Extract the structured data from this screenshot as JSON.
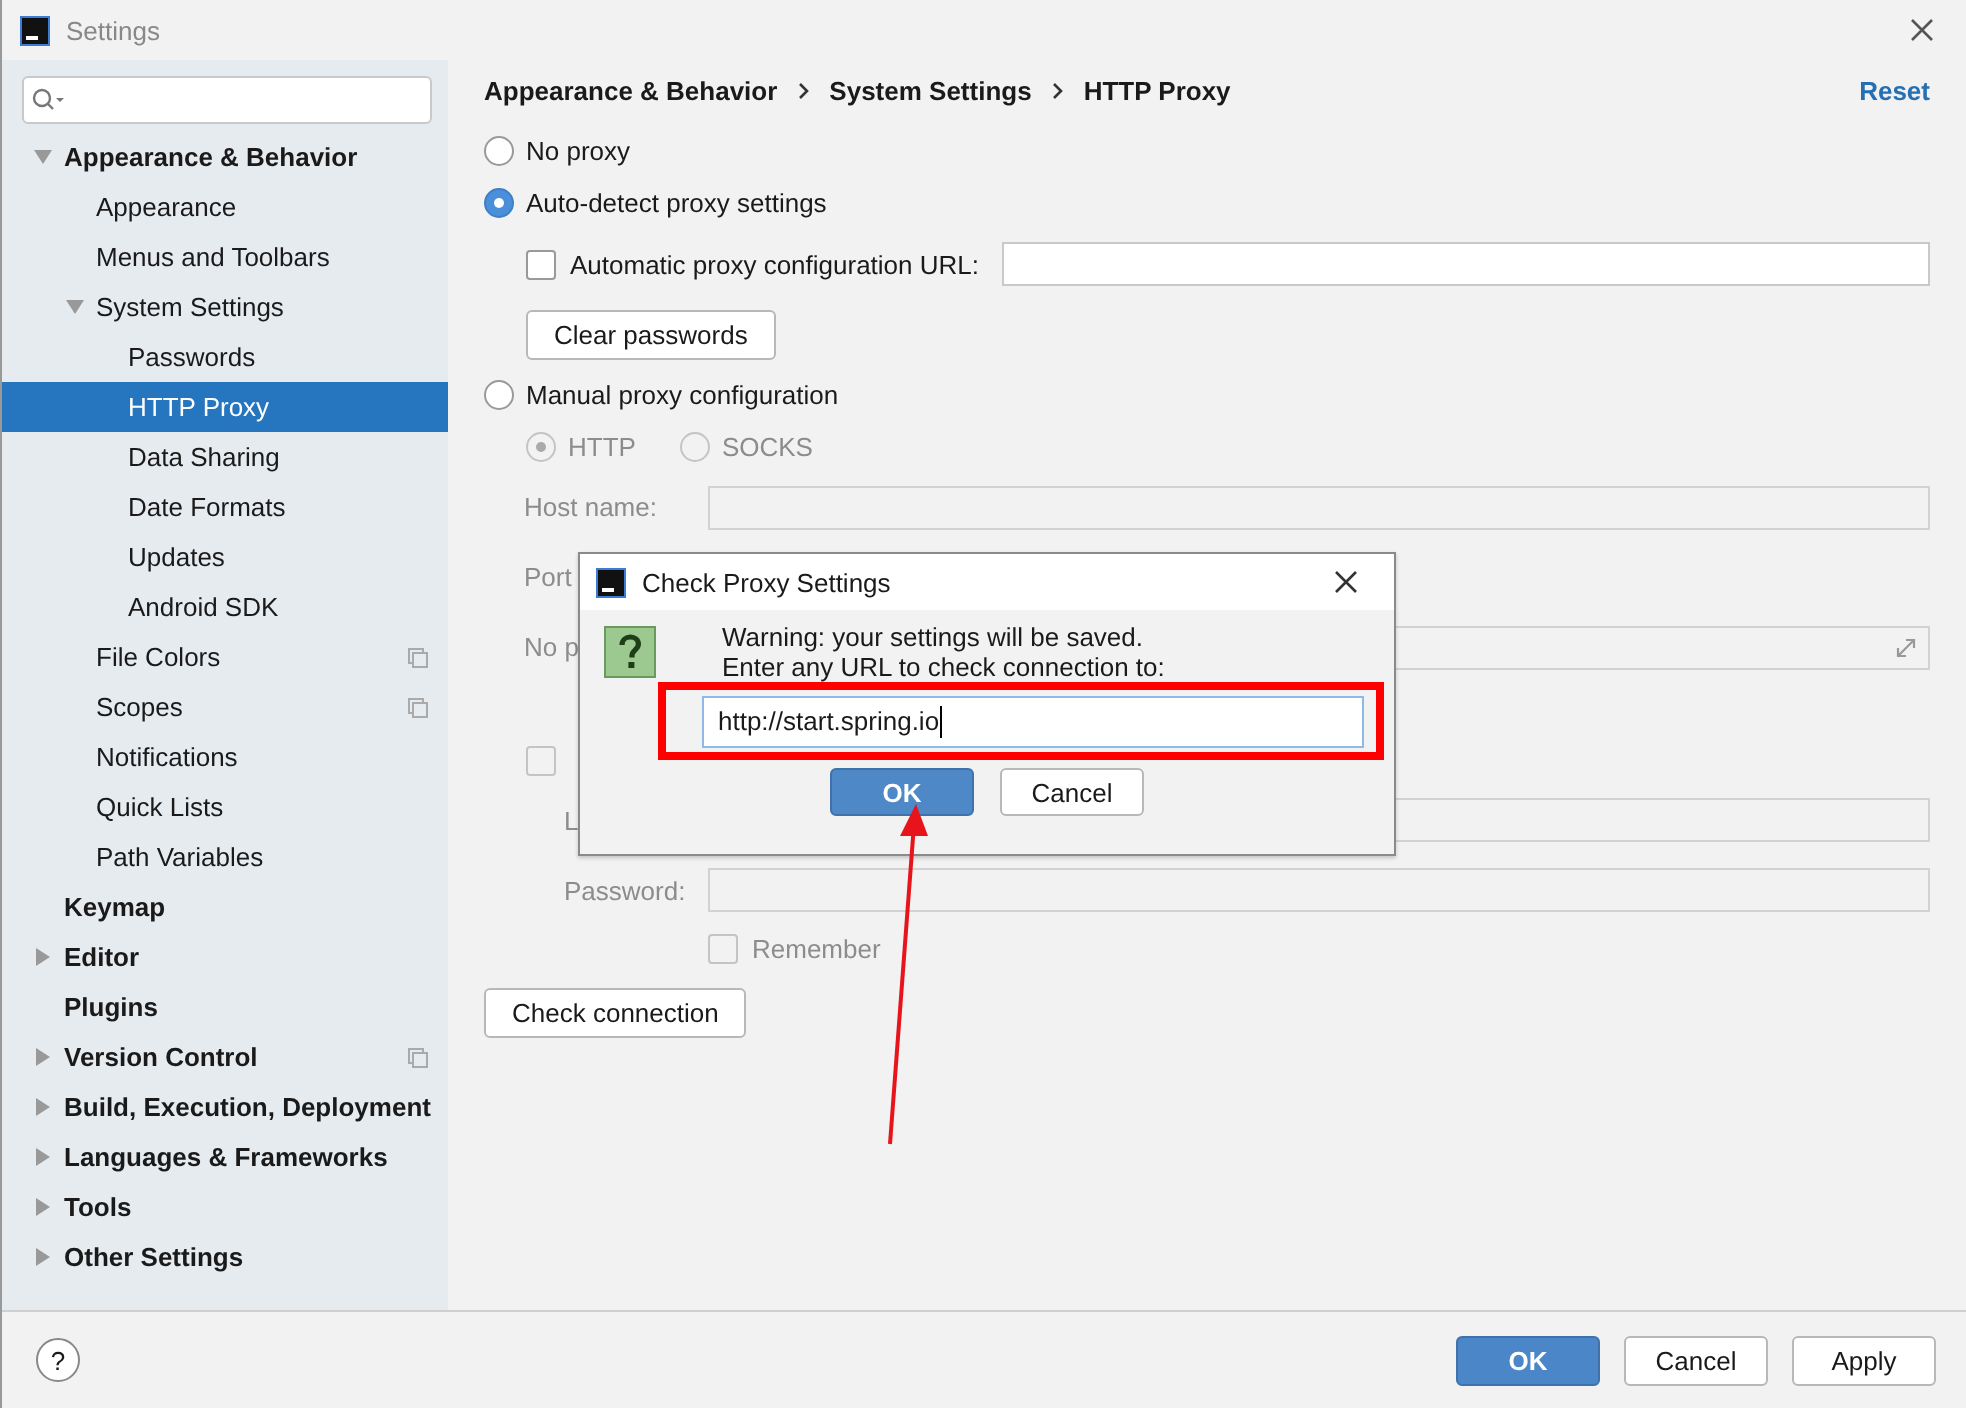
{
  "window": {
    "title": "Settings"
  },
  "sidebar": {
    "items": [
      {
        "label": "Appearance & Behavior",
        "expanded": true,
        "selected": false,
        "children": [
          {
            "label": "Appearance",
            "selected": false
          },
          {
            "label": "Menus and Toolbars",
            "selected": false
          },
          {
            "label": "System Settings",
            "expanded": true,
            "selected": false,
            "children": [
              {
                "label": "Passwords",
                "selected": false
              },
              {
                "label": "HTTP Proxy",
                "selected": true
              },
              {
                "label": "Data Sharing",
                "selected": false
              },
              {
                "label": "Date Formats",
                "selected": false
              },
              {
                "label": "Updates",
                "selected": false
              },
              {
                "label": "Android SDK",
                "selected": false
              }
            ]
          },
          {
            "label": "File Colors",
            "project_icon": true,
            "selected": false
          },
          {
            "label": "Scopes",
            "project_icon": true,
            "selected": false
          },
          {
            "label": "Notifications",
            "selected": false
          },
          {
            "label": "Quick Lists",
            "selected": false
          },
          {
            "label": "Path Variables",
            "selected": false
          }
        ]
      },
      {
        "label": "Keymap",
        "selected": false
      },
      {
        "label": "Editor",
        "expanded": false,
        "selected": false
      },
      {
        "label": "Plugins",
        "selected": false
      },
      {
        "label": "Version Control",
        "expanded": false,
        "project_icon": true,
        "selected": false
      },
      {
        "label": "Build, Execution, Deployment",
        "expanded": false,
        "selected": false
      },
      {
        "label": "Languages & Frameworks",
        "expanded": false,
        "selected": false
      },
      {
        "label": "Tools",
        "expanded": false,
        "selected": false
      },
      {
        "label": "Other Settings",
        "expanded": false,
        "selected": false
      }
    ]
  },
  "breadcrumb": [
    "Appearance & Behavior",
    "System Settings",
    "HTTP Proxy"
  ],
  "reset_link": "Reset",
  "proxy_options": [
    {
      "label": "No proxy",
      "selected": false
    },
    {
      "label": "Auto-detect proxy settings",
      "selected": true
    },
    {
      "label": "Manual proxy configuration",
      "selected": false
    }
  ],
  "auto_detect": {
    "pac_checkbox": {
      "label": "Automatic proxy configuration URL:",
      "checked": false
    },
    "clear_passwords_button": "Clear passwords"
  },
  "manual": {
    "disabled": true,
    "protocols": [
      {
        "label": "HTTP",
        "selected": true
      },
      {
        "label": "SOCKS",
        "selected": false
      }
    ],
    "host_label": "Host name:",
    "port_label": "Port",
    "no_proxy_label": "No p",
    "auth_checkbox": {
      "checked": false
    },
    "login_label": "L",
    "password_label": "Password:",
    "remember_checkbox": {
      "label": "Remember",
      "checked": false
    }
  },
  "check_connection_button": "Check connection",
  "dialog": {
    "title": "Check Proxy Settings",
    "message_lines": [
      "Warning: your settings will be saved.",
      "Enter any URL to check connection to:"
    ],
    "url_value": "http://start.spring.io",
    "ok": "OK",
    "cancel": "Cancel"
  },
  "footer": {
    "help": "?",
    "buttons": [
      {
        "label": "OK",
        "default": true
      },
      {
        "label": "Cancel",
        "default": false
      },
      {
        "label": "Apply",
        "default": false
      }
    ]
  }
}
